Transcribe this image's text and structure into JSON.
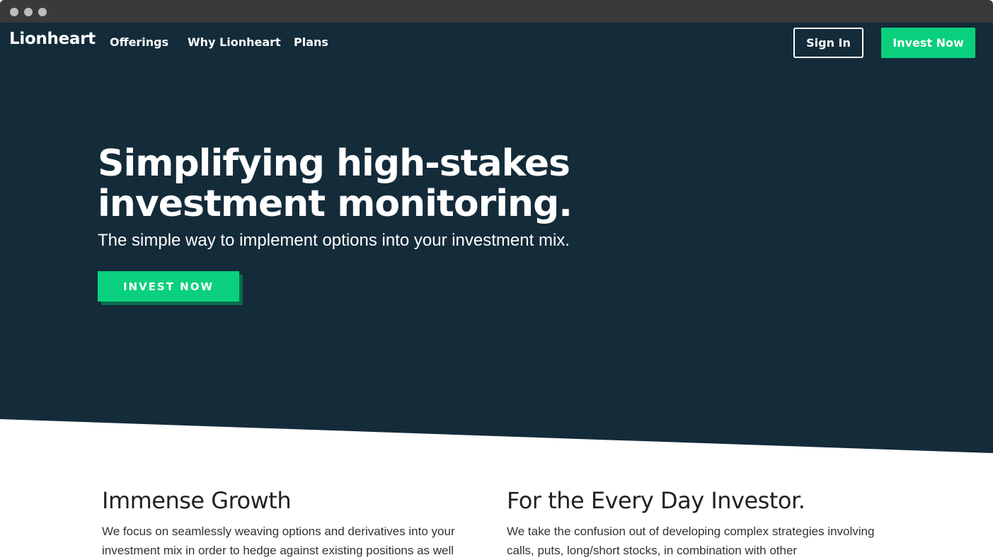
{
  "nav": {
    "logo": "Lionheart",
    "links": [
      "Offerings",
      "Why Lionheart",
      "Plans"
    ],
    "sign_in": "Sign In",
    "invest_now": "Invest Now"
  },
  "hero": {
    "title": "Simplifying high-stakes investment monitoring.",
    "subtitle": "The simple way to implement options into your investment mix.",
    "cta": "INVEST NOW"
  },
  "features": [
    {
      "title": "Immense Growth",
      "text": "We focus on seamlessly weaving options and derivatives into your investment mix in order to hedge against existing positions as well"
    },
    {
      "title": "For the Every Day Investor.",
      "text": "We take the confusion out of developing complex strategies involving calls, puts, long/short stocks, in combination with other"
    }
  ],
  "colors": {
    "hero_bg": "#142b3a",
    "accent": "#0ad07d",
    "cta_shadow": "#0a6b4c"
  }
}
